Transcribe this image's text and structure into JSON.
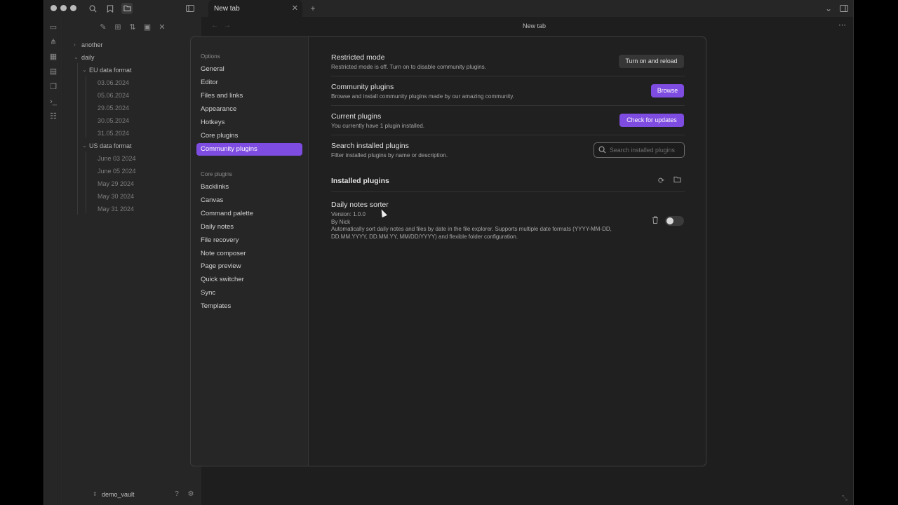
{
  "titlebar": {
    "tab_title": "New tab",
    "tab_close_icon": "close-icon",
    "new_tab_icon": "plus-icon"
  },
  "explorer": {
    "tree": [
      {
        "label": "another",
        "level": 0,
        "expanded": false
      },
      {
        "label": "daily",
        "level": 0,
        "expanded": true
      },
      {
        "label": "EU data format",
        "level": 1,
        "expanded": true
      },
      {
        "label": "03.06.2024",
        "level": 2
      },
      {
        "label": "05.06.2024",
        "level": 2
      },
      {
        "label": "29.05.2024",
        "level": 2
      },
      {
        "label": "30.05.2024",
        "level": 2
      },
      {
        "label": "31.05.2024",
        "level": 2
      },
      {
        "label": "US data format",
        "level": 1,
        "expanded": true
      },
      {
        "label": "June 03 2024",
        "level": 2
      },
      {
        "label": "June 05 2024",
        "level": 2
      },
      {
        "label": "May 29 2024",
        "level": 2
      },
      {
        "label": "May 30 2024",
        "level": 2
      },
      {
        "label": "May 31 2024",
        "level": 2
      }
    ],
    "vault_name": "demo_vault"
  },
  "main": {
    "title": "New tab"
  },
  "settings": {
    "options_heading": "Options",
    "options": [
      "General",
      "Editor",
      "Files and links",
      "Appearance",
      "Hotkeys",
      "Core plugins",
      "Community plugins"
    ],
    "active_option": "Community plugins",
    "core_heading": "Core plugins",
    "core_plugins": [
      "Backlinks",
      "Canvas",
      "Command palette",
      "Daily notes",
      "File recovery",
      "Note composer",
      "Page preview",
      "Quick switcher",
      "Sync",
      "Templates"
    ],
    "restricted": {
      "title": "Restricted mode",
      "desc": "Restricted mode is off. Turn on to disable community plugins.",
      "button": "Turn on and reload"
    },
    "community": {
      "title": "Community plugins",
      "desc": "Browse and install community plugins made by our amazing community.",
      "button": "Browse"
    },
    "current": {
      "title": "Current plugins",
      "desc": "You currently have 1 plugin installed.",
      "button": "Check for updates"
    },
    "search": {
      "title": "Search installed plugins",
      "desc": "Filter installed plugins by name or description.",
      "placeholder": "Search installed plugins"
    },
    "installed": {
      "title": "Installed plugins",
      "plugins": [
        {
          "name": "Daily notes sorter",
          "version": "Version: 1.0.0",
          "author": "By Nick",
          "description_line1": "Automatically sort daily notes and files by date in the file explorer. Supports multiple date formats (YYYY-MM-DD,",
          "description_line2": "DD.MM.YYYY, DD.MM.YY, MM/DD/YYYY) and flexible folder configuration.",
          "enabled": false
        }
      ]
    }
  },
  "colors": {
    "accent": "#7e4ce0",
    "background": "#1e1e1e",
    "sidebar": "#262626"
  }
}
